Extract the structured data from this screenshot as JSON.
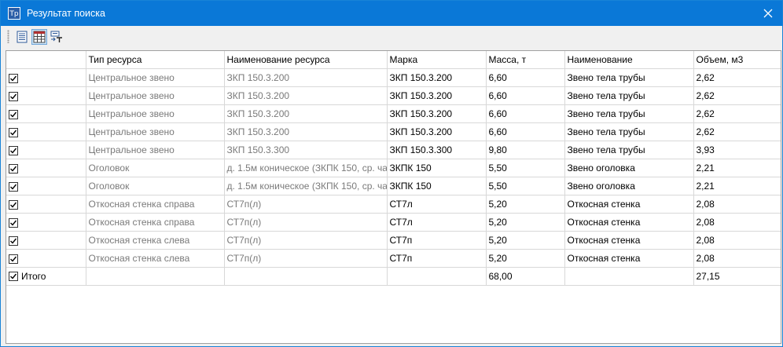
{
  "window": {
    "title": "Результат поиска",
    "app_icon_text": "Тр"
  },
  "toolbar": {
    "buttons": [
      "list-view-icon",
      "column-chooser-icon",
      "sum-field-icon"
    ]
  },
  "table": {
    "headers": [
      "",
      "Тип ресурса",
      "Наименование ресурса",
      "Марка",
      "Масса, т",
      "Наименование",
      "Объем, м3"
    ],
    "sorted_column": "Марка",
    "rows": [
      {
        "checked": true,
        "type": "Центральное звено",
        "resource": "ЗКП 150.3.200",
        "mark": "ЗКП 150.3.200",
        "mass": "6,60",
        "name": "Звено тела трубы",
        "volume": "2,62"
      },
      {
        "checked": true,
        "type": "Центральное звено",
        "resource": "ЗКП 150.3.200",
        "mark": "ЗКП 150.3.200",
        "mass": "6,60",
        "name": "Звено тела трубы",
        "volume": "2,62"
      },
      {
        "checked": true,
        "type": "Центральное звено",
        "resource": "ЗКП 150.3.200",
        "mark": "ЗКП 150.3.200",
        "mass": "6,60",
        "name": "Звено тела трубы",
        "volume": "2,62"
      },
      {
        "checked": true,
        "type": "Центральное звено",
        "resource": "ЗКП 150.3.200",
        "mark": "ЗКП 150.3.200",
        "mass": "6,60",
        "name": "Звено тела трубы",
        "volume": "2,62"
      },
      {
        "checked": true,
        "type": "Центральное звено",
        "resource": "ЗКП 150.3.300",
        "mark": "ЗКП 150.3.300",
        "mass": "9,80",
        "name": "Звено тела трубы",
        "volume": "3,93"
      },
      {
        "checked": true,
        "type": "Оголовок",
        "resource": "д. 1.5м коническое (ЗКПК 150, ср. ча...",
        "mark": "ЗКПК 150",
        "mass": "5,50",
        "name": "Звено оголовка",
        "volume": "2,21"
      },
      {
        "checked": true,
        "type": "Оголовок",
        "resource": "д. 1.5м коническое (ЗКПК 150, ср. ча...",
        "mark": "ЗКПК 150",
        "mass": "5,50",
        "name": "Звено оголовка",
        "volume": "2,21"
      },
      {
        "checked": true,
        "type": "Откосная стенка справа",
        "resource": "СТ7п(л)",
        "mark": "СТ7л",
        "mass": "5,20",
        "name": "Откосная стенка",
        "volume": "2,08"
      },
      {
        "checked": true,
        "type": "Откосная стенка справа",
        "resource": "СТ7п(л)",
        "mark": "СТ7л",
        "mass": "5,20",
        "name": "Откосная стенка",
        "volume": "2,08"
      },
      {
        "checked": true,
        "type": "Откосная стенка слева",
        "resource": "СТ7п(л)",
        "mark": "СТ7п",
        "mass": "5,20",
        "name": "Откосная стенка",
        "volume": "2,08"
      },
      {
        "checked": true,
        "type": "Откосная стенка слева",
        "resource": "СТ7п(л)",
        "mark": "СТ7п",
        "mass": "5,20",
        "name": "Откосная стенка",
        "volume": "2,08"
      }
    ],
    "total": {
      "checked": true,
      "label": "Итого",
      "mass": "68,00",
      "volume": "27,15"
    }
  }
}
